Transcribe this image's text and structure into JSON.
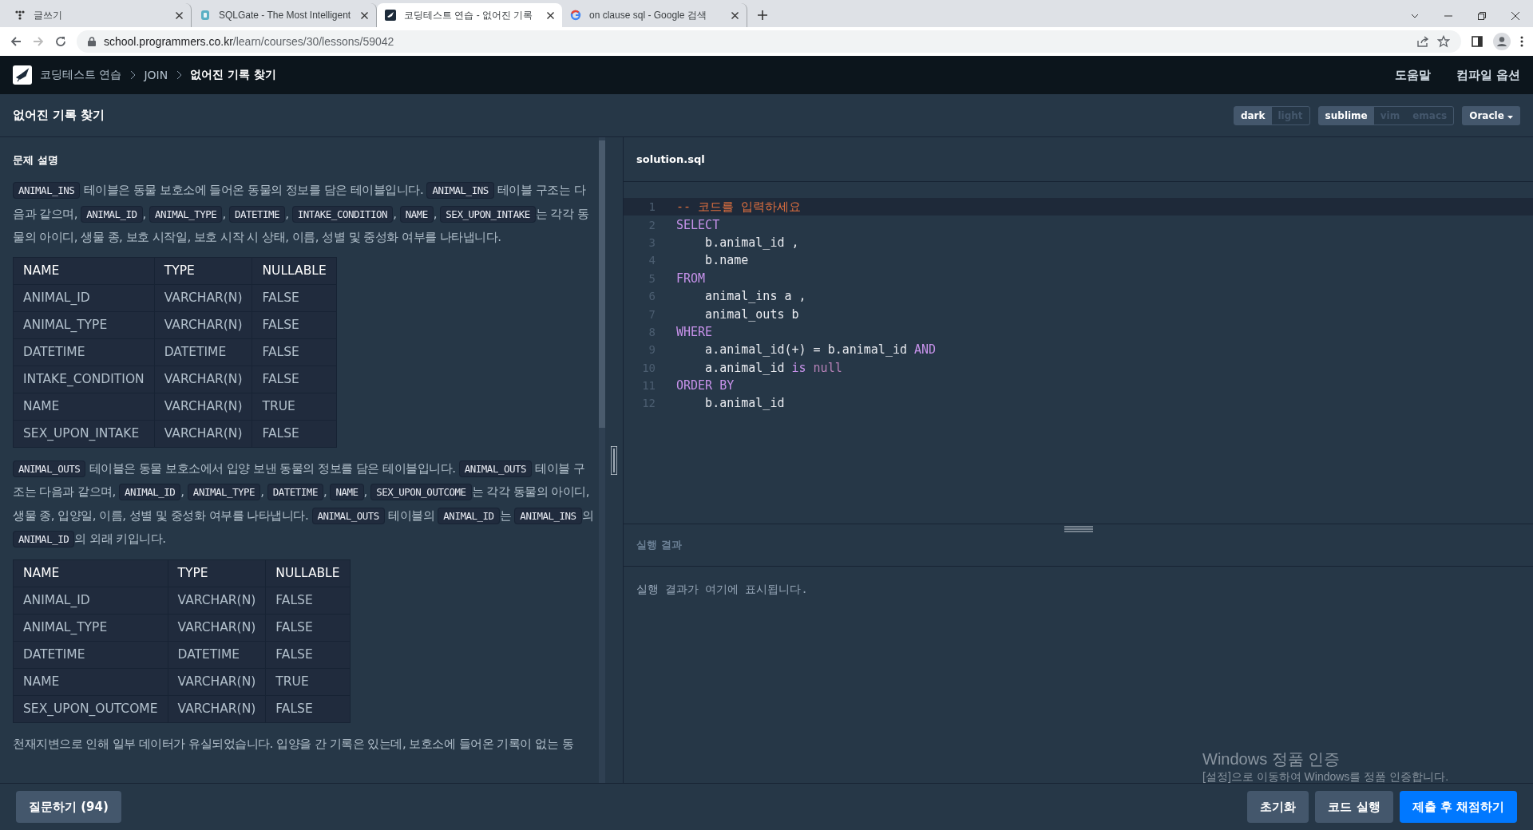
{
  "browser": {
    "tabs": [
      {
        "title": "글쓰기",
        "selected": false
      },
      {
        "title": "SQLGate - The Most Intelligent",
        "selected": false
      },
      {
        "title": "코딩테스트 연습 - 없어진 기록",
        "selected": true
      },
      {
        "title": "on clause sql - Google 검색",
        "selected": false
      }
    ],
    "address": {
      "host": "school.programmers.co.kr",
      "path": "/learn/courses/30/lessons/59042"
    }
  },
  "nav": {
    "breadcrumbs": [
      {
        "label": "코딩테스트 연습",
        "current": false
      },
      {
        "label": "JOIN",
        "current": false
      },
      {
        "label": "없어진 기록 찾기",
        "current": true
      }
    ],
    "links": [
      "도움말",
      "컴파일 옵션"
    ]
  },
  "title": "없어진 기록 찾기",
  "theme_toggle": [
    {
      "label": "dark",
      "selected": true
    },
    {
      "label": "light",
      "selected": false
    }
  ],
  "keymap_toggle": [
    {
      "label": "sublime",
      "selected": true
    },
    {
      "label": "vim",
      "selected": false
    },
    {
      "label": "emacs",
      "selected": false
    }
  ],
  "language": "Oracle",
  "problem": {
    "heading": "문제 설명",
    "blocks": [
      {
        "kind": "paragraph",
        "segments": [
          {
            "kind": "code",
            "text": "ANIMAL_INS"
          },
          {
            "kind": "text",
            "text": " 테이블은 동물 보호소에 들어온 동물의 정보를 담은 테이블입니다. "
          },
          {
            "kind": "code",
            "text": "ANIMAL_INS"
          },
          {
            "kind": "text",
            "text": " 테이블 구조는 다음과 같으며, "
          },
          {
            "kind": "code",
            "text": "ANIMAL_ID"
          },
          {
            "kind": "text",
            "text": ", "
          },
          {
            "kind": "code",
            "text": "ANIMAL_TYPE"
          },
          {
            "kind": "text",
            "text": ", "
          },
          {
            "kind": "code",
            "text": "DATETIME"
          },
          {
            "kind": "text",
            "text": ", "
          },
          {
            "kind": "code",
            "text": "INTAKE_CONDITION"
          },
          {
            "kind": "text",
            "text": ", "
          },
          {
            "kind": "code",
            "text": "NAME"
          },
          {
            "kind": "text",
            "text": ", "
          },
          {
            "kind": "code",
            "text": "SEX_UPON_INTAKE"
          },
          {
            "kind": "text",
            "text": "는 각각 동물의 아이디, 생물 종, 보호 시작일, 보호 시작 시 상태, 이름, 성별 및 중성화 여부를 나타냅니다."
          }
        ]
      },
      {
        "kind": "table",
        "columns": [
          "NAME",
          "TYPE",
          "NULLABLE"
        ],
        "rows": [
          [
            "ANIMAL_ID",
            "VARCHAR(N)",
            "FALSE"
          ],
          [
            "ANIMAL_TYPE",
            "VARCHAR(N)",
            "FALSE"
          ],
          [
            "DATETIME",
            "DATETIME",
            "FALSE"
          ],
          [
            "INTAKE_CONDITION",
            "VARCHAR(N)",
            "FALSE"
          ],
          [
            "NAME",
            "VARCHAR(N)",
            "TRUE"
          ],
          [
            "SEX_UPON_INTAKE",
            "VARCHAR(N)",
            "FALSE"
          ]
        ]
      },
      {
        "kind": "paragraph",
        "segments": [
          {
            "kind": "code",
            "text": "ANIMAL_OUTS"
          },
          {
            "kind": "text",
            "text": " 테이블은 동물 보호소에서 입양 보낸 동물의 정보를 담은 테이블입니다. "
          },
          {
            "kind": "code",
            "text": "ANIMAL_OUTS"
          },
          {
            "kind": "text",
            "text": " 테이블 구조는 다음과 같으며, "
          },
          {
            "kind": "code",
            "text": "ANIMAL_ID"
          },
          {
            "kind": "text",
            "text": ", "
          },
          {
            "kind": "code",
            "text": "ANIMAL_TYPE"
          },
          {
            "kind": "text",
            "text": ", "
          },
          {
            "kind": "code",
            "text": "DATETIME"
          },
          {
            "kind": "text",
            "text": ", "
          },
          {
            "kind": "code",
            "text": "NAME"
          },
          {
            "kind": "text",
            "text": ", "
          },
          {
            "kind": "code",
            "text": "SEX_UPON_OUTCOME"
          },
          {
            "kind": "text",
            "text": "는 각각 동물의 아이디, 생물 종, 입양일, 이름, 성별 및 중성화 여부를 나타냅니다. "
          },
          {
            "kind": "code",
            "text": "ANIMAL_OUTS"
          },
          {
            "kind": "text",
            "text": " 테이블의 "
          },
          {
            "kind": "code",
            "text": "ANIMAL_ID"
          },
          {
            "kind": "text",
            "text": "는 "
          },
          {
            "kind": "code",
            "text": "ANIMAL_INS"
          },
          {
            "kind": "text",
            "text": "의 "
          },
          {
            "kind": "code",
            "text": "ANIMAL_ID"
          },
          {
            "kind": "text",
            "text": "의 외래 키입니다."
          }
        ]
      },
      {
        "kind": "table",
        "columns": [
          "NAME",
          "TYPE",
          "NULLABLE"
        ],
        "rows": [
          [
            "ANIMAL_ID",
            "VARCHAR(N)",
            "FALSE"
          ],
          [
            "ANIMAL_TYPE",
            "VARCHAR(N)",
            "FALSE"
          ],
          [
            "DATETIME",
            "DATETIME",
            "FALSE"
          ],
          [
            "NAME",
            "VARCHAR(N)",
            "TRUE"
          ],
          [
            "SEX_UPON_OUTCOME",
            "VARCHAR(N)",
            "FALSE"
          ]
        ]
      },
      {
        "kind": "paragraph",
        "segments": [
          {
            "kind": "text",
            "text": "천재지변으로 인해 일부 데이터가 유실되었습니다. 입양을 간 기록은 있는데, 보호소에 들어온 기록이 없는 동"
          }
        ]
      }
    ]
  },
  "editor": {
    "filename": "solution.sql",
    "lines": [
      {
        "number": "1",
        "active": true,
        "tokens": [
          {
            "kind": "comment",
            "text": "-- 코드를 입력하세요"
          }
        ]
      },
      {
        "number": "2",
        "active": false,
        "tokens": [
          {
            "kind": "keyword",
            "text": "SELECT"
          }
        ]
      },
      {
        "number": "3",
        "active": false,
        "tokens": [
          {
            "kind": "plain",
            "text": "    b.animal_id ,"
          }
        ]
      },
      {
        "number": "4",
        "active": false,
        "tokens": [
          {
            "kind": "plain",
            "text": "    b.name"
          }
        ]
      },
      {
        "number": "5",
        "active": false,
        "tokens": [
          {
            "kind": "keyword",
            "text": "FROM"
          }
        ]
      },
      {
        "number": "6",
        "active": false,
        "tokens": [
          {
            "kind": "plain",
            "text": "    animal_ins a ,"
          }
        ]
      },
      {
        "number": "7",
        "active": false,
        "tokens": [
          {
            "kind": "plain",
            "text": "    animal_outs b"
          }
        ]
      },
      {
        "number": "8",
        "active": false,
        "tokens": [
          {
            "kind": "keyword",
            "text": "WHERE"
          }
        ]
      },
      {
        "number": "9",
        "active": false,
        "tokens": [
          {
            "kind": "plain",
            "text": "    a.animal_id(+) = b.animal_id "
          },
          {
            "kind": "keyword",
            "text": "AND"
          }
        ]
      },
      {
        "number": "10",
        "active": false,
        "tokens": [
          {
            "kind": "plain",
            "text": "    a.animal_id "
          },
          {
            "kind": "keyword",
            "text": "is"
          },
          {
            "kind": "literal",
            "text": " null"
          }
        ]
      },
      {
        "number": "11",
        "active": false,
        "tokens": [
          {
            "kind": "keyword",
            "text": "ORDER BY"
          }
        ]
      },
      {
        "number": "12",
        "active": false,
        "tokens": [
          {
            "kind": "plain",
            "text": "    b.animal_id"
          }
        ]
      }
    ]
  },
  "result": {
    "heading": "실행 결과",
    "message": "실행 결과가 여기에 표시됩니다."
  },
  "footer": {
    "ask_button": "질문하기 (94)",
    "buttons": [
      {
        "label": "초기화",
        "kind": "secondary"
      },
      {
        "label": "코드 실행",
        "kind": "secondary"
      },
      {
        "label": "제출 후 채점하기",
        "kind": "primary"
      }
    ]
  },
  "windows_notice": {
    "title": "Windows 정품 인증",
    "text": "[설정]으로 이동하여 Windows를 정품 인증합니다."
  }
}
